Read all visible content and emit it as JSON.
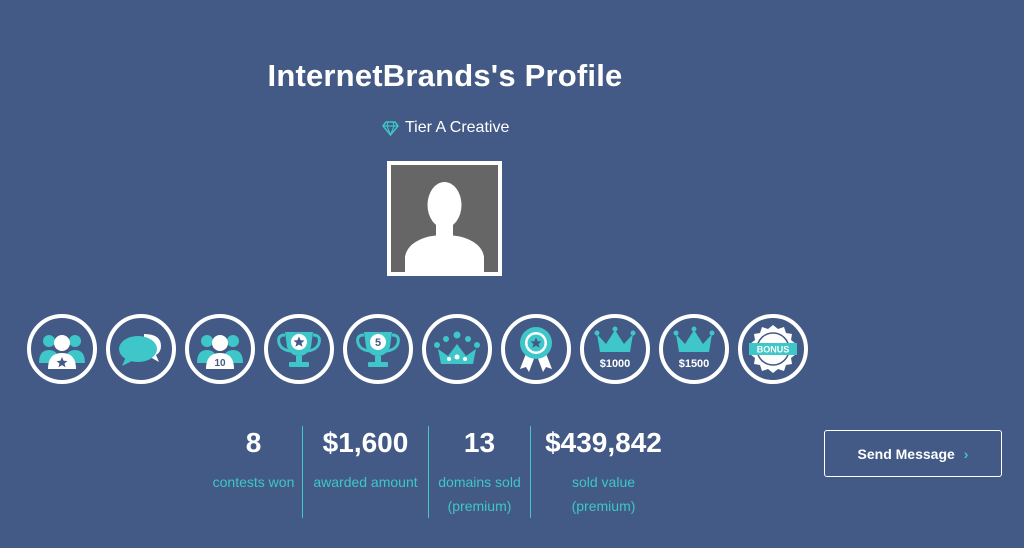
{
  "profile": {
    "title": "InternetBrands's Profile",
    "tier_label": "Tier A Creative",
    "tier_icon": "diamond-icon",
    "avatar_icon": "default-user-silhouette"
  },
  "badges": [
    {
      "icon": "community-star-icon"
    },
    {
      "icon": "chat-bubbles-icon"
    },
    {
      "icon": "community-10-icon",
      "text": "10"
    },
    {
      "icon": "trophy-star-icon"
    },
    {
      "icon": "trophy-5-icon",
      "text": "5"
    },
    {
      "icon": "crown-dots-icon"
    },
    {
      "icon": "award-ribbon-icon"
    },
    {
      "icon": "crown-1000-icon",
      "text": "$1000"
    },
    {
      "icon": "crown-1500-icon",
      "text": "$1500"
    },
    {
      "icon": "bonus-badge-icon",
      "text": "BONUS"
    }
  ],
  "stats": [
    {
      "value": "8",
      "label": "contests won",
      "sub": ""
    },
    {
      "value": "$1,600",
      "label": "awarded amount",
      "sub": ""
    },
    {
      "value": "13",
      "label": "domains sold",
      "sub": "(premium)"
    },
    {
      "value": "$439,842",
      "label": "sold value",
      "sub": "(premium)"
    }
  ],
  "actions": {
    "send_message": "Send Message",
    "send_message_icon": "chevron-right-icon"
  },
  "colors": {
    "background": "#435a86",
    "accent": "#3ec6c9",
    "text": "#ffffff"
  }
}
